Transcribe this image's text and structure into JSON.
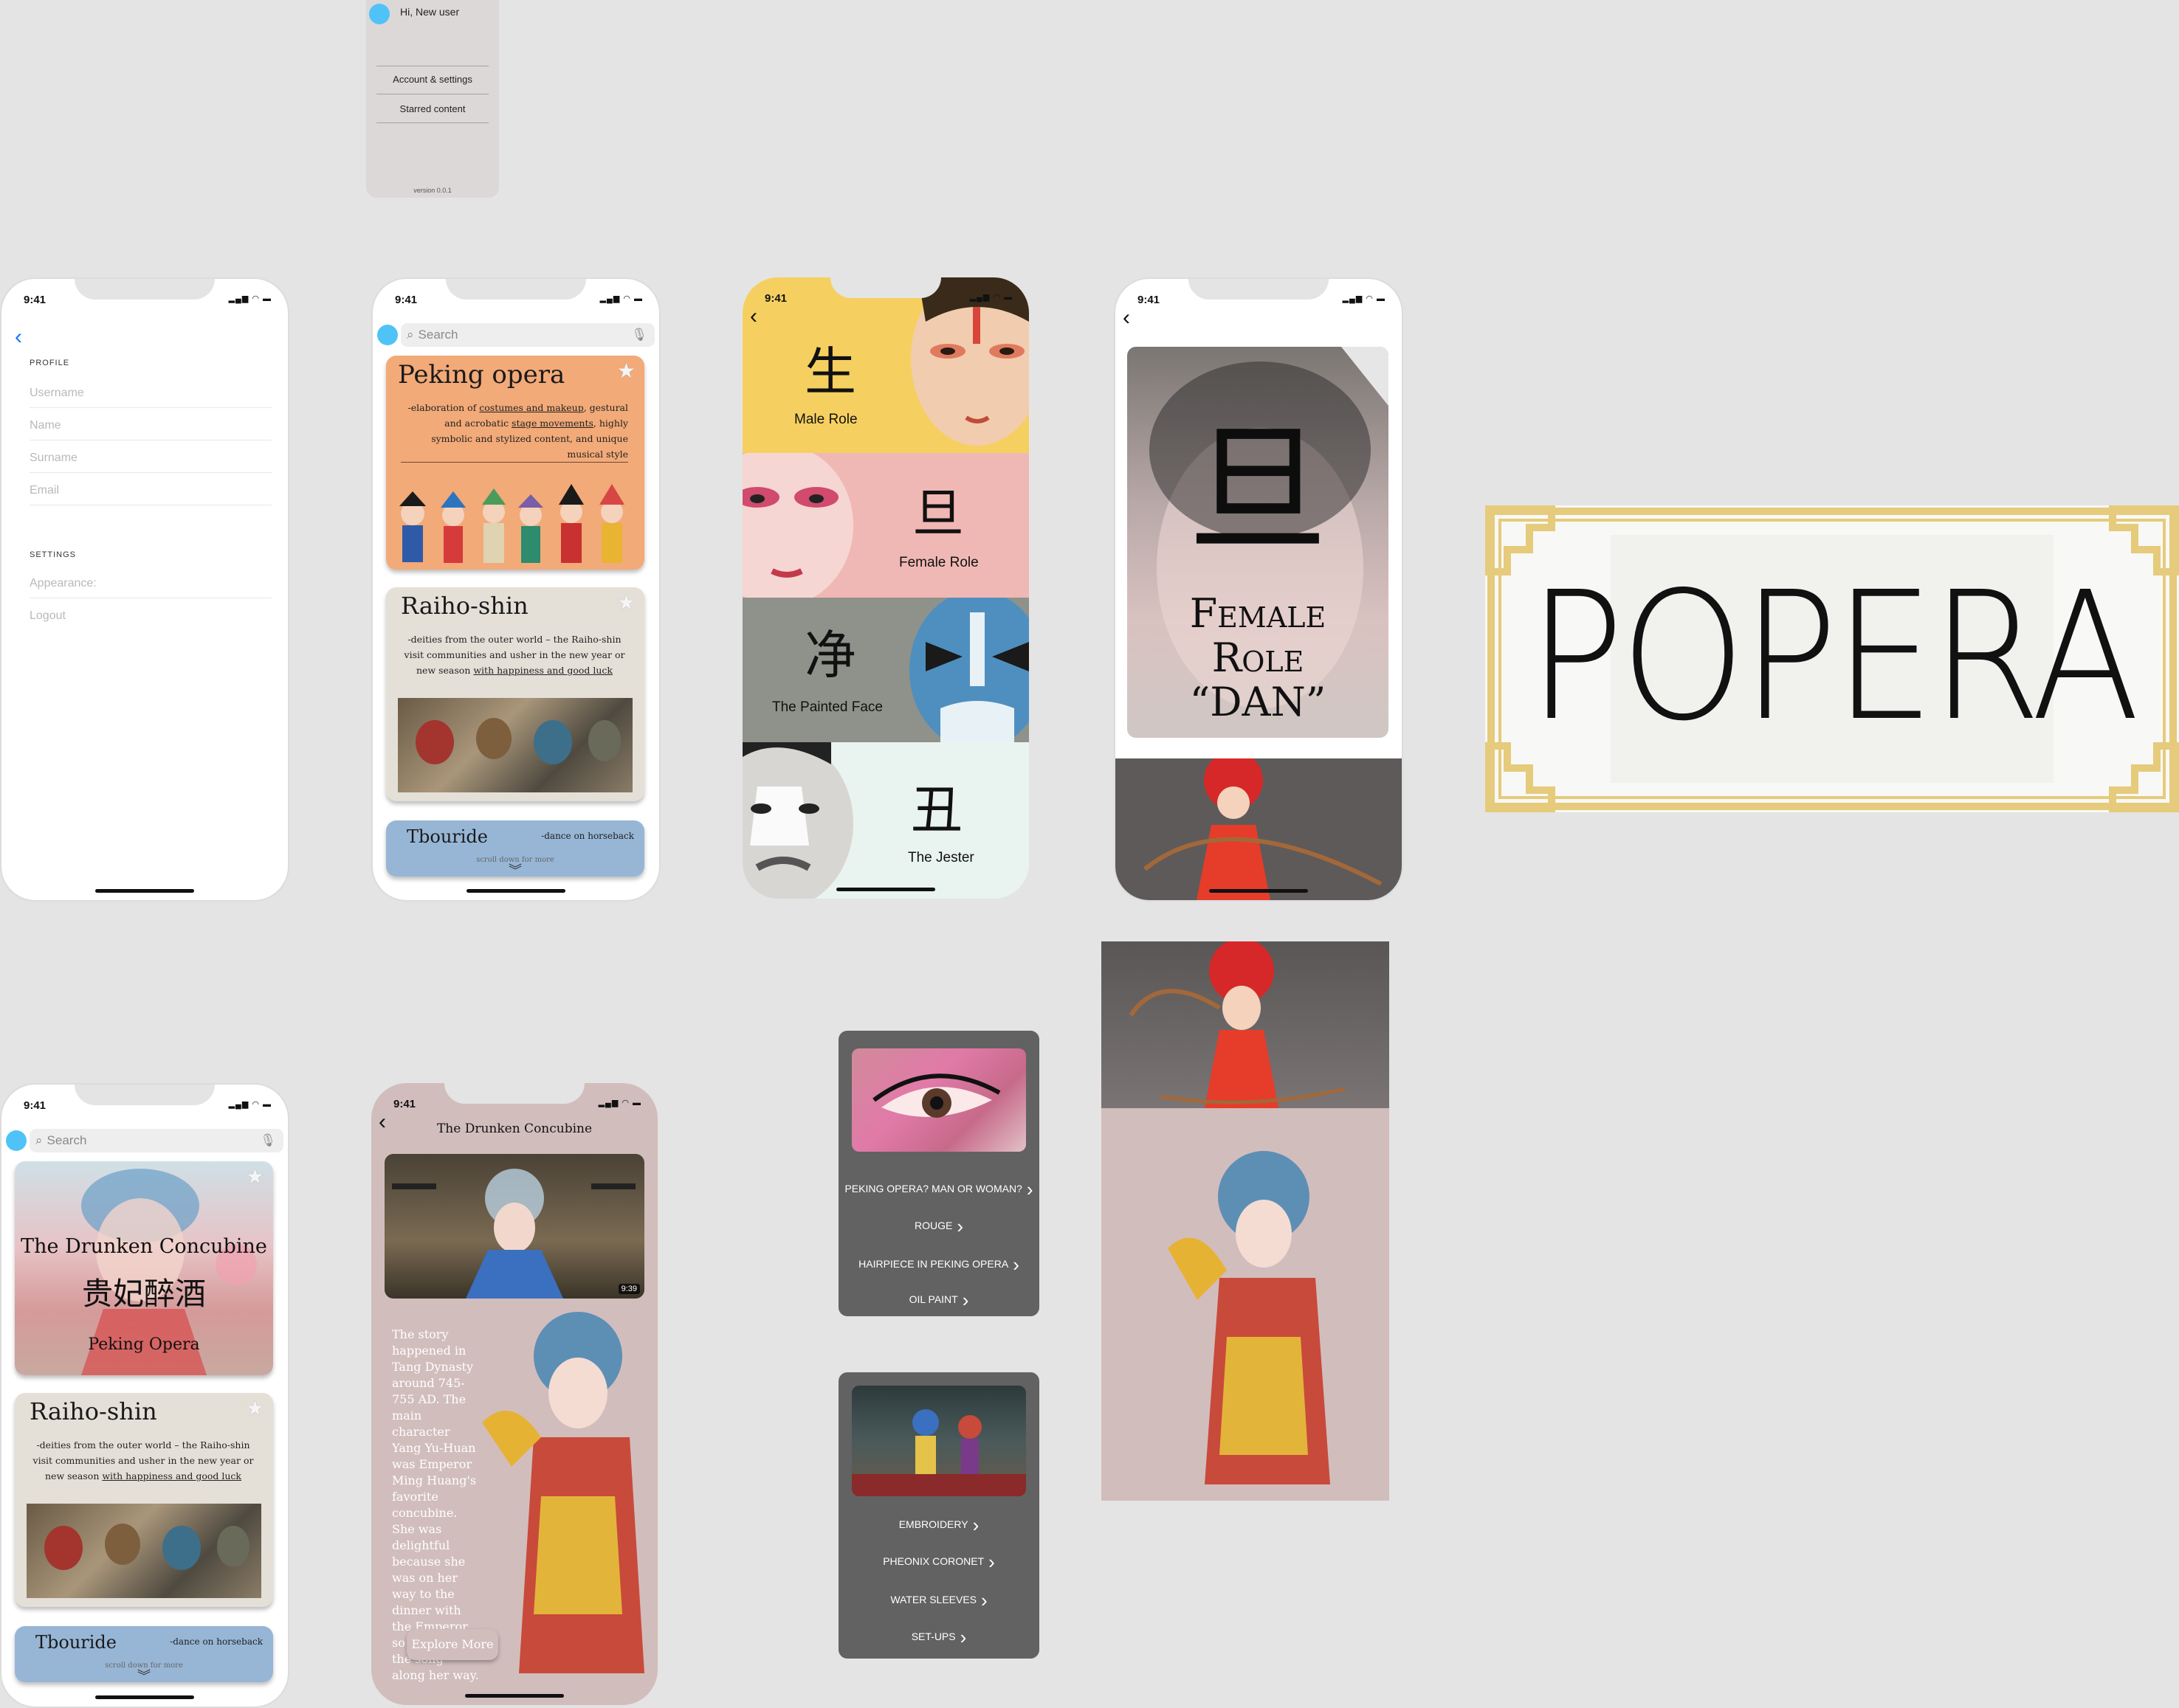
{
  "status_time": "9:41",
  "drawer": {
    "greeting": "Hi, New user",
    "account": "Account & settings",
    "starred": "Starred content",
    "version": "version 0.0.1"
  },
  "profile": {
    "profile_label": "PROFILE",
    "fields": [
      "Username",
      "Name",
      "Surname",
      "Email"
    ],
    "settings_label": "SETTINGS",
    "settings_fields": [
      "Appearance:",
      "Logout"
    ]
  },
  "home": {
    "search_placeholder": "Search",
    "card1": {
      "title": "Peking opera",
      "desc_pre": "-elaboration of ",
      "desc_link1": "costumes and makeup",
      "desc_mid": ", gestural and acrobatic ",
      "desc_link2": "stage movements",
      "desc_post": ", highly symbolic and stylized content, and unique musical style"
    },
    "card2": {
      "title": "Raiho-shin",
      "desc_pre": "-deities from the outer world – the Raiho-shin visit communities and usher in the new year or new season ",
      "desc_link": "with happiness and good luck"
    },
    "card3": {
      "title": "Tbouride",
      "desc": "-dance on horseback",
      "scroll_hint": "scroll down for more"
    }
  },
  "roles": [
    {
      "glyph": "生",
      "label": "Male Role",
      "color": "#f5d060"
    },
    {
      "glyph": "旦",
      "label": "Female Role",
      "color": "#f0b8b4"
    },
    {
      "glyph": "净",
      "label": "The Painted Face",
      "color": "#8e928a"
    },
    {
      "glyph": "丑",
      "label": "The Jester",
      "color": "#e9f3ef"
    }
  ],
  "female": {
    "glyph": "旦",
    "title_line1": "Female",
    "title_line2": "Role",
    "title_line3": "“DAN”"
  },
  "logo": {
    "text": "POPERA"
  },
  "home2": {
    "search_placeholder": "Search",
    "card1": {
      "title": "The Drunken Concubine",
      "chinese": "贵妃醉酒",
      "subtitle": "Peking Opera"
    },
    "card2": {
      "title": "Raiho-shin",
      "desc_pre": "-deities from the outer world – the Raiho-shin visit communities and usher in the new year or new season ",
      "desc_link": "with happiness and good luck"
    },
    "card3": {
      "title": "Tbouride",
      "desc": "-dance on horseback",
      "scroll_hint": "scroll down for more"
    }
  },
  "story": {
    "header": "The Drunken Concubine",
    "video_time": "9:39",
    "text": "The story happened in Tang Dynasty around 745-755 AD. The main character Yang Yu-Huan was Emperor Ming Huang's favorite concubine. She was delightful because she was on her way to the dinner with the Emperor, so she sing the song along her way.",
    "button": "Explore More"
  },
  "menu1": [
    "PEKING OPERA? MAN OR WOMAN?",
    "ROUGE",
    "HAIRPIECE IN PEKING OPERA",
    "OIL PAINT"
  ],
  "menu2": [
    "EMBROIDERY",
    "PHEONIX CORONET",
    "WATER SLEEVES",
    "SET-UPS"
  ]
}
